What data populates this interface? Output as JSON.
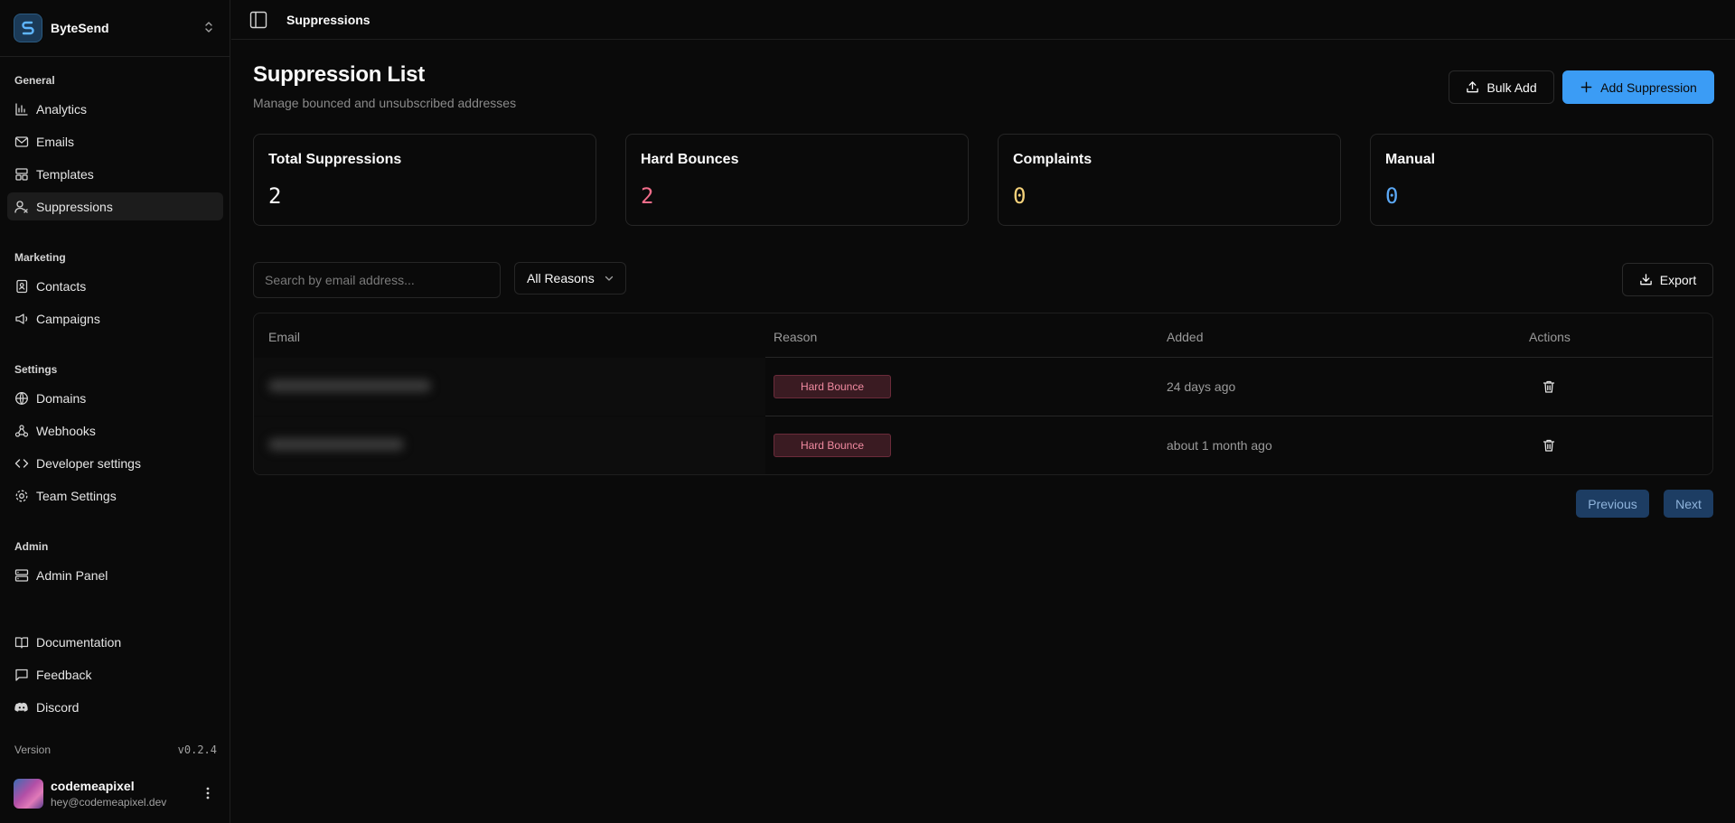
{
  "brand": {
    "name": "ByteSend"
  },
  "sidebar": {
    "groups": [
      {
        "label": "General",
        "items": [
          {
            "label": "Analytics",
            "icon": "bar-chart-icon"
          },
          {
            "label": "Emails",
            "icon": "mail-icon"
          },
          {
            "label": "Templates",
            "icon": "layout-template-icon"
          },
          {
            "label": "Suppressions",
            "icon": "user-x-icon",
            "active": true
          }
        ]
      },
      {
        "label": "Marketing",
        "items": [
          {
            "label": "Contacts",
            "icon": "contact-book-icon"
          },
          {
            "label": "Campaigns",
            "icon": "megaphone-icon"
          }
        ]
      },
      {
        "label": "Settings",
        "items": [
          {
            "label": "Domains",
            "icon": "globe-icon"
          },
          {
            "label": "Webhooks",
            "icon": "webhook-icon"
          },
          {
            "label": "Developer settings",
            "icon": "code-icon"
          },
          {
            "label": "Team Settings",
            "icon": "settings-gear-icon"
          }
        ]
      },
      {
        "label": "Admin",
        "items": [
          {
            "label": "Admin Panel",
            "icon": "server-icon"
          }
        ]
      }
    ],
    "footer_links": [
      {
        "label": "Documentation",
        "icon": "book-icon"
      },
      {
        "label": "Feedback",
        "icon": "message-square-icon"
      },
      {
        "label": "Discord",
        "icon": "discord-icon"
      }
    ],
    "version_label": "Version",
    "version_value": "v0.2.4",
    "user": {
      "name": "codemeapixel",
      "email": "hey@codemeapixel.dev"
    }
  },
  "topbar": {
    "title": "Suppressions"
  },
  "header": {
    "title": "Suppression List",
    "subtitle": "Manage bounced and unsubscribed addresses",
    "bulk_add_label": "Bulk Add",
    "add_label": "Add Suppression"
  },
  "stats": [
    {
      "label": "Total Suppressions",
      "value": "2",
      "color": "#fafafa"
    },
    {
      "label": "Hard Bounces",
      "value": "2",
      "color": "#f26d8a"
    },
    {
      "label": "Complaints",
      "value": "0",
      "color": "#f5d27a"
    },
    {
      "label": "Manual",
      "value": "0",
      "color": "#5ba8f5"
    }
  ],
  "filters": {
    "search_placeholder": "Search by email address...",
    "reason_selected": "All Reasons",
    "export_label": "Export"
  },
  "table": {
    "headers": {
      "email": "Email",
      "reason": "Reason",
      "added": "Added",
      "actions": "Actions"
    },
    "rows": [
      {
        "reason": "Hard Bounce",
        "added": "24 days ago"
      },
      {
        "reason": "Hard Bounce",
        "added": "about 1 month ago"
      }
    ]
  },
  "pagination": {
    "previous": "Previous",
    "next": "Next"
  }
}
